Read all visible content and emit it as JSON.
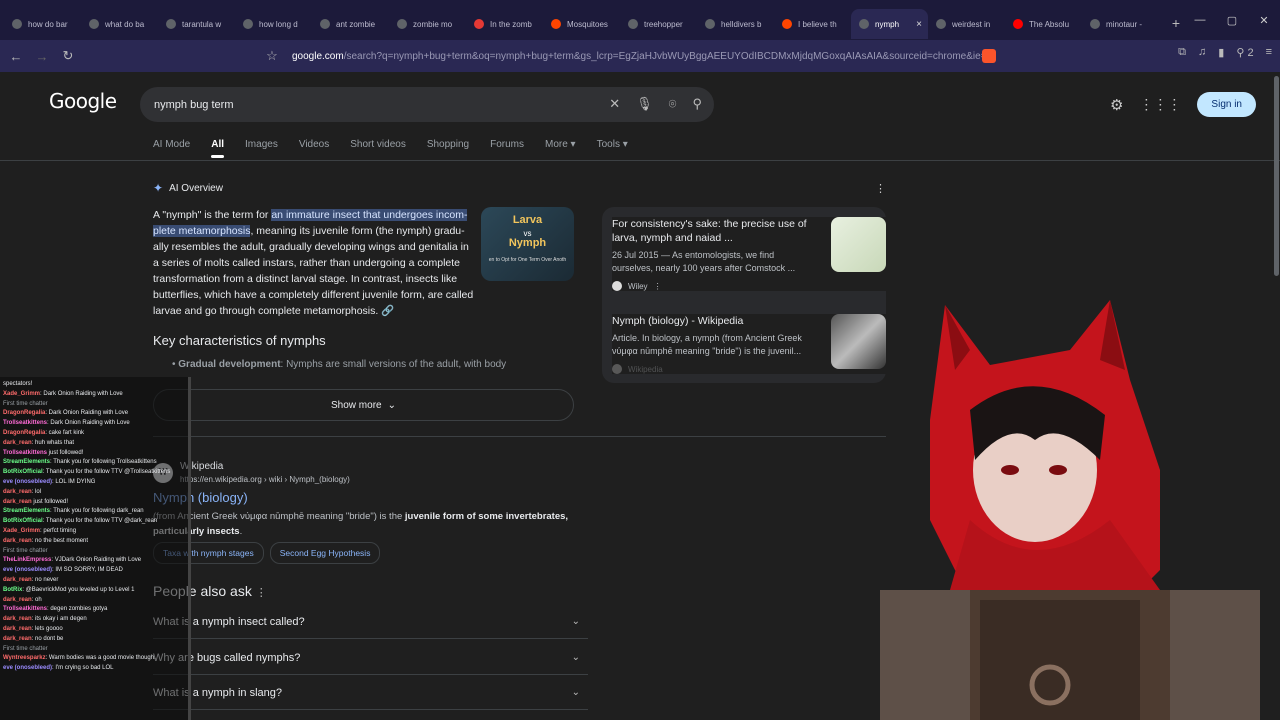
{
  "tabs": [
    {
      "label": "how do bar",
      "color": "#5f6368"
    },
    {
      "label": "what do ba",
      "color": "#5f6368"
    },
    {
      "label": "tarantula w",
      "color": "#5f6368"
    },
    {
      "label": "how long d",
      "color": "#5f6368"
    },
    {
      "label": "ant zombie",
      "color": "#5f6368"
    },
    {
      "label": "zombie mo",
      "color": "#5f6368"
    },
    {
      "label": "In the zomb",
      "color": "#e53935"
    },
    {
      "label": "Mosquitoes",
      "color": "#ff4500"
    },
    {
      "label": "treehopper",
      "color": "#5f6368"
    },
    {
      "label": "helldivers b",
      "color": "#5f6368"
    },
    {
      "label": "I believe th",
      "color": "#ff4500"
    },
    {
      "label": "nymph",
      "color": "#5f6368",
      "active": true
    },
    {
      "label": "weirdest in",
      "color": "#5f6368"
    },
    {
      "label": "The Absolu",
      "color": "#ff0000"
    },
    {
      "label": "minotaur -",
      "color": "#5f6368"
    }
  ],
  "tab_close": "×",
  "new_tab": "+",
  "window": {
    "minimize": "—",
    "maximize": "▢",
    "close": "✕"
  },
  "address": {
    "host": "google.com",
    "path": "/search?q=nymph+bug+term&oq=nymph+bug+term&gs_lcrp=EgZjaHJvbWUyBggAEEUYOdIBCDMxMjdqMGoxqAIAsAIA&sourceid=chrome&ie=...",
    "extension_count": "2"
  },
  "google": {
    "logo": "Google",
    "query": "nymph bug term",
    "signin": "Sign in",
    "filters": [
      "AI Mode",
      "All",
      "Images",
      "Videos",
      "Short videos",
      "Shopping",
      "Forums",
      "More ▾",
      "Tools ▾"
    ]
  },
  "ai_overview": {
    "label": "AI Overview",
    "p_pre": "A \"nymph\" is the term for ",
    "p_hl": "an immature insect that undergoes incom-plete metamorphosis",
    "p_post": ", meaning its juvenile form (the nymph) gradu-ally resembles the adult, gradually developing wings and genitalia in a series of molts called instars, rather than undergoing a complete transformation from a distinct larval stage. In contrast, insects like butterflies, which have a completely different juvenile form, are called larvae and go through complete metamorphosis.",
    "image_text": {
      "t1": "Larva",
      "t2": "vs",
      "t3": "Nymph",
      "t4": "en to Opt for One Term Over Anoth"
    },
    "key_heading": "Key characteristics of nymphs",
    "bullet_bold": "Gradual development",
    "bullet_text": ": Nymphs are small versions of the adult, with body",
    "show_more": "Show more",
    "sources": [
      {
        "title": "For consistency's sake: the precise use of larva, nymph and naiad ...",
        "snippet": "26 Jul 2015 — As entomologists, we find ourselves, nearly 100 years after Comstock ...",
        "site": "Wiley"
      },
      {
        "title": "Nymph (biology) - Wikipedia",
        "snippet": "Article. In biology, a nymph (from Ancient Greek νύμφα nūmphē meaning \"bride\") is the juvenil...",
        "site": "Wikipedia"
      }
    ]
  },
  "wiki_result": {
    "site": "Wikipedia",
    "url": "https://en.wikipedia.org › wiki › Nymph_(biology)",
    "title": "Nymph (biology)",
    "snippet_pre": "(from Ancient Greek νύμφα nūmphē meaning \"bride\") is the ",
    "snippet_bold": "juvenile form of some invertebrates, particularly insects",
    "snippet_post": ".",
    "chips": [
      "Taxa with nymph stages",
      "Second Egg Hypothesis"
    ]
  },
  "paa": {
    "heading": "People also ask",
    "questions": [
      "What is a nymph insect called?",
      "Why are bugs called nymphs?",
      "What is a nymph in slang?"
    ]
  },
  "chat": [
    {
      "user": "",
      "text": "spectators!",
      "color": "#e8eaed"
    },
    {
      "user": "Xade_Grimm",
      "text": ": Dark Onion Raiding with Love",
      "color": "#ff6b6b"
    },
    {
      "user": "",
      "text": "First time chatter",
      "color": "#9aa0a6"
    },
    {
      "user": "DragonRegalia",
      "text": ": Dark Onion Raiding with Love",
      "color": "#ff6b6b"
    },
    {
      "user": "Trollseatkittens",
      "text": ": Dark Onion Raiding with Love",
      "color": "#ff6bd6"
    },
    {
      "user": "DragonRegalia",
      "text": ": cake fart kink",
      "color": "#ff6b6b"
    },
    {
      "user": "dark_rean",
      "text": ": huh whats that",
      "color": "#ff6b6b"
    },
    {
      "user": "Trollseatkittens",
      "text": " just followed!",
      "color": "#ff6bd6"
    },
    {
      "user": "StreamElements",
      "text": ": Thank you for following Trollseatkittens",
      "color": "#6bff8a"
    },
    {
      "user": "BotRixOfficial",
      "text": ": Thank you for the follow TTV @Trollseatkittens",
      "color": "#6bff8a"
    },
    {
      "user": "eve (onosebleed)",
      "text": ": LOL IM DYING",
      "color": "#9b8cff"
    },
    {
      "user": "dark_rean",
      "text": ": lol",
      "color": "#ff6b6b"
    },
    {
      "user": "dark_rean",
      "text": " just followed!",
      "color": "#ff6b6b"
    },
    {
      "user": "StreamElements",
      "text": ": Thank you for following dark_rean",
      "color": "#6bff8a"
    },
    {
      "user": "BotRixOfficial",
      "text": ": Thank you for the follow TTV @dark_rean",
      "color": "#6bff8a"
    },
    {
      "user": "Xade_Grimm",
      "text": ": perfct timing",
      "color": "#ff6b6b"
    },
    {
      "user": "dark_rean",
      "text": ": no the best moment",
      "color": "#ff6b6b"
    },
    {
      "user": "",
      "text": "First time chatter",
      "color": "#9aa0a6"
    },
    {
      "user": "TheLinkEmpress",
      "text": ": VJDark Onion Raiding with Love",
      "color": "#ff6bd6"
    },
    {
      "user": "eve (onosebleed)",
      "text": ": IM SO SORRY, IM DEAD",
      "color": "#9b8cff"
    },
    {
      "user": "dark_rean",
      "text": ": no never",
      "color": "#ff6b6b"
    },
    {
      "user": "BotRix",
      "text": ": @BaevrickMod you leveled up to Level 1",
      "color": "#6bff8a"
    },
    {
      "user": "dark_rean",
      "text": ": oh",
      "color": "#ff6b6b"
    },
    {
      "user": "Trollseatkittens",
      "text": ": degen zombies gotya",
      "color": "#ff6bd6"
    },
    {
      "user": "dark_rean",
      "text": ": its okay i am degen",
      "color": "#ff6b6b"
    },
    {
      "user": "dark_rean",
      "text": ": lets goooo",
      "color": "#ff6b6b"
    },
    {
      "user": "dark_rean",
      "text": ": no dont be",
      "color": "#ff6b6b"
    },
    {
      "user": "",
      "text": "First time chatter",
      "color": "#9aa0a6"
    },
    {
      "user": "Wyntreesparkz",
      "text": ": Warm bodies was a good movie though.",
      "color": "#ff6b6b"
    },
    {
      "user": "eve (onosebleed)",
      "text": ": I'm crying so bad LOL",
      "color": "#9b8cff"
    }
  ],
  "colors": {
    "accent": "#8ab4f8",
    "tabstrip": "#1c1a3a",
    "addrbar": "#2a2853"
  }
}
